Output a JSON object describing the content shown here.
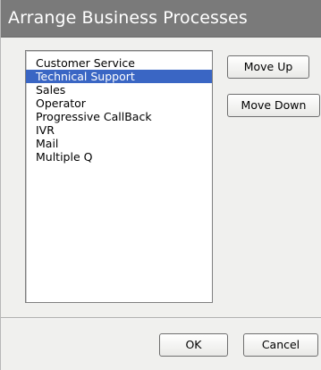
{
  "dialog": {
    "title": "Arrange Business Processes"
  },
  "process_list": {
    "selected_index": 1,
    "items": [
      "Customer Service",
      "Technical Support",
      "Sales",
      "Operator",
      "Progressive CallBack",
      "IVR",
      "Mail",
      "Multiple Q"
    ]
  },
  "buttons": {
    "move_up": "Move Up",
    "move_down": "Move Down",
    "ok": "OK",
    "cancel": "Cancel"
  },
  "colors": {
    "titlebar": "#7a7a7a",
    "selection": "#3a66c4",
    "background": "#f0f0ee"
  }
}
